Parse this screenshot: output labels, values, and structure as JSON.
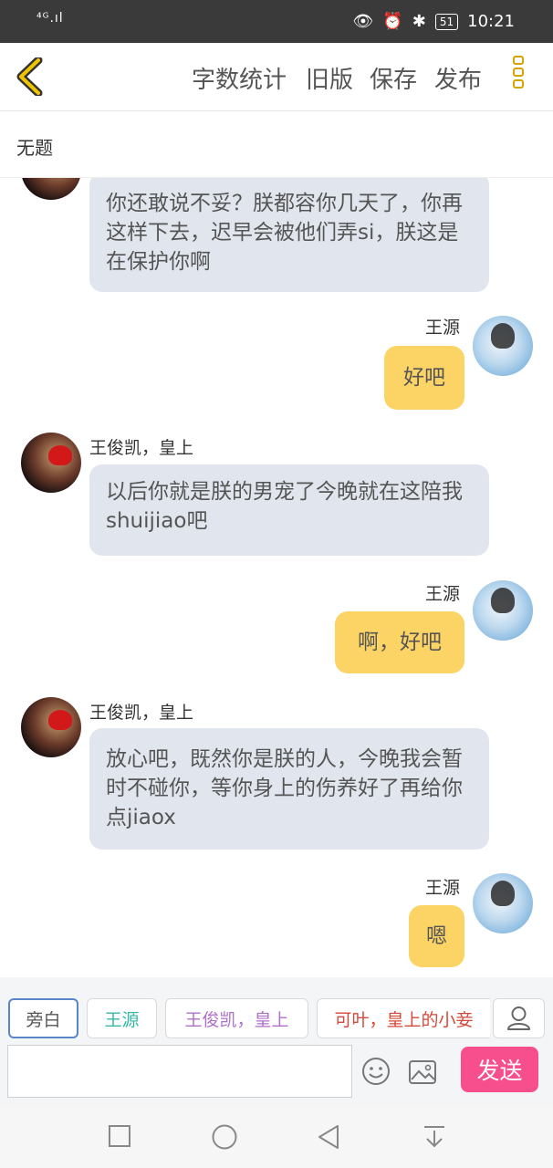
{
  "statusbar": {
    "signal": "⁴ᴳ.ıl",
    "battery": "51",
    "time": "10:21"
  },
  "toolbar": {
    "word_count": "字数统计",
    "old_version": "旧版",
    "save": "保存",
    "publish": "发布"
  },
  "doc": {
    "title": "无题"
  },
  "messages": [
    {
      "side": "left",
      "name": "",
      "text": "你还敢说不妥？朕都容你几天了，你再这样下去，迟早会被他们弄si，朕这是在保护你啊"
    },
    {
      "side": "right",
      "name": "王源",
      "text": "好吧"
    },
    {
      "side": "left",
      "name": "王俊凯，皇上",
      "text": "以后你就是朕的男宠了今晚就在这陪我shuijiao吧"
    },
    {
      "side": "right",
      "name": "王源",
      "text": "啊，好吧"
    },
    {
      "side": "left",
      "name": "王俊凯，皇上",
      "text": "放心吧，既然你是朕的人，今晚我会暂时不碰你，等你身上的伤养好了再给你点jiaox"
    },
    {
      "side": "right",
      "name": "王源",
      "text": "嗯"
    }
  ],
  "roles": [
    {
      "label": "旁白",
      "color": "#555555"
    },
    {
      "label": "王源",
      "color": "#35b7a6"
    },
    {
      "label": "王俊凯，皇上",
      "color": "#b070c8"
    },
    {
      "label": "可叶，皇上的小妾",
      "color": "#d14a3a"
    }
  ],
  "composer": {
    "placeholder": "",
    "send_label": "发送"
  },
  "colors": {
    "accent": "#d4a400",
    "left_bubble": "#e1e6ee",
    "right_bubble": "#fcd466",
    "send": "#f74f8e"
  }
}
